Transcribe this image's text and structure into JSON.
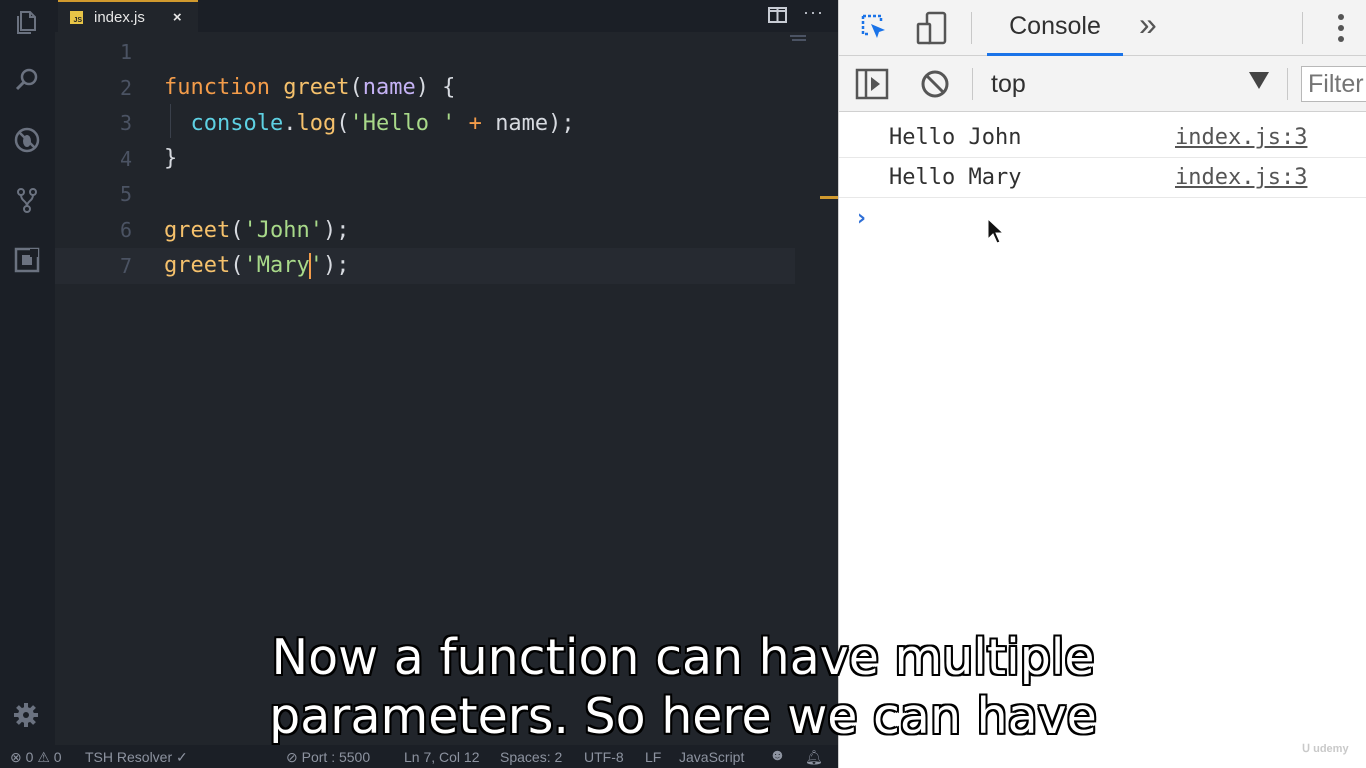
{
  "editor": {
    "tab": {
      "badge": "JS",
      "filename": "index.js",
      "close": "×"
    },
    "more": "···",
    "lines": [
      {
        "num": "1",
        "tokens": []
      },
      {
        "num": "2",
        "tokens": [
          {
            "t": "function",
            "c": "kw"
          },
          {
            "t": " ",
            "c": "punc"
          },
          {
            "t": "greet",
            "c": "fn"
          },
          {
            "t": "(",
            "c": "punc"
          },
          {
            "t": "name",
            "c": "param"
          },
          {
            "t": ") {",
            "c": "punc"
          }
        ]
      },
      {
        "num": "3",
        "tokens": [
          {
            "t": "  ",
            "c": "punc"
          },
          {
            "t": "console",
            "c": "obj"
          },
          {
            "t": ".",
            "c": "punc"
          },
          {
            "t": "log",
            "c": "fn"
          },
          {
            "t": "(",
            "c": "punc"
          },
          {
            "t": "'Hello '",
            "c": "str"
          },
          {
            "t": " + ",
            "c": "op"
          },
          {
            "t": "name",
            "c": "punc"
          },
          {
            "t": ");",
            "c": "punc"
          }
        ]
      },
      {
        "num": "4",
        "tokens": [
          {
            "t": "}",
            "c": "punc"
          }
        ]
      },
      {
        "num": "5",
        "tokens": []
      },
      {
        "num": "6",
        "tokens": [
          {
            "t": "greet",
            "c": "fn"
          },
          {
            "t": "(",
            "c": "punc"
          },
          {
            "t": "'John'",
            "c": "str"
          },
          {
            "t": ");",
            "c": "punc"
          }
        ]
      },
      {
        "num": "7",
        "tokens": [
          {
            "t": "greet",
            "c": "fn"
          },
          {
            "t": "(",
            "c": "punc"
          },
          {
            "t": "'Mary",
            "c": "str"
          },
          {
            "t": "|CURSOR|",
            "c": "cursor"
          },
          {
            "t": "'",
            "c": "str"
          },
          {
            "t": ");",
            "c": "punc"
          }
        ]
      }
    ]
  },
  "status": {
    "errors": "0",
    "warnings": "0",
    "resolver": "TSH Resolver ✓",
    "port": "Port : 5500",
    "position": "Ln 7, Col 12",
    "spaces": "Spaces: 2",
    "encoding": "UTF-8",
    "eol": "LF",
    "language": "JavaScript"
  },
  "devtools": {
    "tab_console": "Console",
    "more_tabs": "»",
    "context": "top",
    "filter_placeholder": "Filter",
    "logs": [
      {
        "message": "Hello John",
        "source": "index.js:3"
      },
      {
        "message": "Hello Mary",
        "source": "index.js:3"
      }
    ],
    "prompt": "›"
  },
  "captions": {
    "line1": "Now a function can have multiple",
    "line2": "parameters. So here we can have"
  },
  "colors": {
    "accent_tab": "#d19a2e",
    "console_underline": "#1a73e8"
  }
}
